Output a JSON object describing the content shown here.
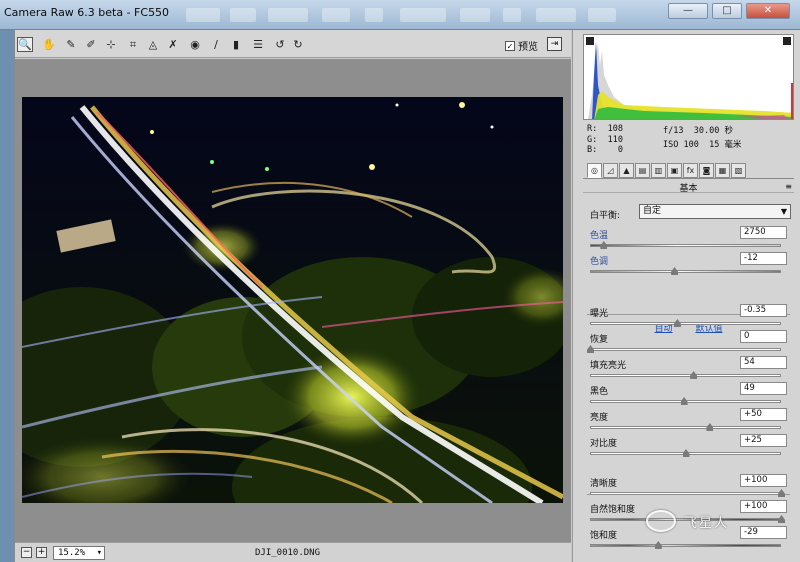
{
  "window": {
    "title": "Camera Raw 6.3 beta - FC550",
    "controls": {
      "minimize": "—",
      "maximize": "□",
      "close": "✕"
    }
  },
  "toolbar": {
    "tools": [
      {
        "name": "zoom-tool-icon",
        "glyph": "🔍",
        "active": true
      },
      {
        "name": "hand-tool-icon",
        "glyph": "✋"
      },
      {
        "name": "white-balance-tool-icon",
        "glyph": "✎"
      },
      {
        "name": "color-sampler-tool-icon",
        "glyph": "✐"
      },
      {
        "name": "targeted-adjustment-tool-icon",
        "glyph": "⊹"
      },
      {
        "name": "crop-tool-icon",
        "glyph": "⌗"
      },
      {
        "name": "straighten-tool-icon",
        "glyph": "◬"
      },
      {
        "name": "spot-removal-tool-icon",
        "glyph": "✗"
      },
      {
        "name": "red-eye-removal-tool-icon",
        "glyph": "◉"
      },
      {
        "name": "adjustment-brush-icon",
        "glyph": "∕"
      },
      {
        "name": "graduated-filter-icon",
        "glyph": "▮"
      },
      {
        "name": "preferences-icon",
        "glyph": "☰"
      },
      {
        "name": "rotate-left-icon",
        "glyph": "↺"
      },
      {
        "name": "rotate-right-icon",
        "glyph": "↻"
      }
    ],
    "preview_label": "预览",
    "preview_checked": true,
    "check_glyph": "✓",
    "fullscreen_glyph": "⇥"
  },
  "status": {
    "zoom_out": "−",
    "zoom_in": "+",
    "zoom_value": "15.2%",
    "zoom_caret": "▾",
    "filename": "DJI_0010.DNG"
  },
  "readout": {
    "r_label": "R:",
    "r_value": "108",
    "g_label": "G:",
    "g_value": "110",
    "b_label": "B:",
    "b_value": "0",
    "aperture": "f/13",
    "shutter": "30.00 秒",
    "iso": "ISO 100",
    "focal": "15 毫米"
  },
  "tabs": [
    {
      "name": "basic-tab-icon",
      "glyph": "◎",
      "active": true
    },
    {
      "name": "tone-curve-tab-icon",
      "glyph": "◿"
    },
    {
      "name": "detail-tab-icon",
      "glyph": "▲"
    },
    {
      "name": "hsl-tab-icon",
      "glyph": "▤"
    },
    {
      "name": "split-toning-tab-icon",
      "glyph": "▥"
    },
    {
      "name": "lens-corrections-tab-icon",
      "glyph": "▣"
    },
    {
      "name": "effects-tab-icon",
      "glyph": "fx"
    },
    {
      "name": "camera-calibration-tab-icon",
      "glyph": "◙"
    },
    {
      "name": "presets-tab-icon",
      "glyph": "▦"
    },
    {
      "name": "snapshots-tab-icon",
      "glyph": "▧"
    }
  ],
  "panel": {
    "section_title": "基本",
    "menu_glyph": "≡",
    "wb_label": "白平衡:",
    "wb_value": "自定",
    "select_caret": "▼",
    "auto_link": "自动",
    "default_link": "默认值"
  },
  "sliders": [
    {
      "id": "temperature",
      "label": "色温",
      "value": "2750",
      "pos": 0.07,
      "blue": true
    },
    {
      "id": "tint",
      "label": "色调",
      "value": "-12",
      "pos": 0.44,
      "blue": true
    },
    {
      "id": "exposure",
      "label": "曝光",
      "value": "-0.35",
      "pos": 0.455
    },
    {
      "id": "recovery",
      "label": "恢复",
      "value": "0",
      "pos": 0.0
    },
    {
      "id": "fill-light",
      "label": "填充亮光",
      "value": "54",
      "pos": 0.54
    },
    {
      "id": "blacks",
      "label": "黑色",
      "value": "49",
      "pos": 0.49
    },
    {
      "id": "brightness",
      "label": "亮度",
      "value": "+50",
      "pos": 0.625
    },
    {
      "id": "contrast",
      "label": "对比度",
      "value": "+25",
      "pos": 0.5
    },
    {
      "id": "clarity",
      "label": "清晰度",
      "value": "+100",
      "pos": 1.0
    },
    {
      "id": "vibrance",
      "label": "自然饱和度",
      "value": "+100",
      "pos": 1.0
    },
    {
      "id": "saturation",
      "label": "饱和度",
      "value": "-29",
      "pos": 0.355
    }
  ],
  "watermark": {
    "text": "飞星人"
  }
}
